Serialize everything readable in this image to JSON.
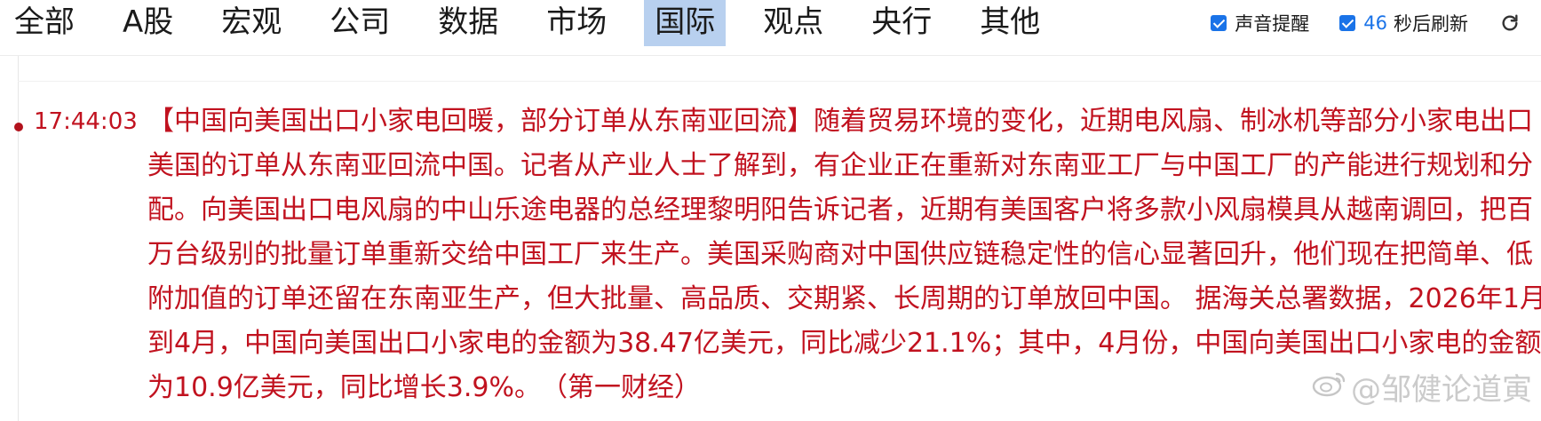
{
  "tabs": [
    {
      "label": "全部",
      "active": false
    },
    {
      "label": "A股",
      "active": false
    },
    {
      "label": "宏观",
      "active": false
    },
    {
      "label": "公司",
      "active": false
    },
    {
      "label": "数据",
      "active": false
    },
    {
      "label": "市场",
      "active": false
    },
    {
      "label": "国际",
      "active": true
    },
    {
      "label": "观点",
      "active": false
    },
    {
      "label": "央行",
      "active": false
    },
    {
      "label": "其他",
      "active": false
    }
  ],
  "controls": {
    "sound_label": "声音提醒",
    "sound_checked": true,
    "refresh_countdown": "46",
    "refresh_suffix": "秒后刷新",
    "refresh_checked": true,
    "refresh_icon": "refresh-icon"
  },
  "news": {
    "time": "17:44:03",
    "content": "【中国向美国出口小家电回暖，部分订单从东南亚回流】随着贸易环境的变化，近期电风扇、制冰机等部分小家电出口美国的订单从东南亚回流中国。记者从产业人士了解到，有企业正在重新对东南亚工厂与中国工厂的产能进行规划和分配。向美国出口电风扇的中山乐途电器的总经理黎明阳告诉记者，近期有美国客户将多款小风扇模具从越南调回，把百万台级别的批量订单重新交给中国工厂来生产。美国采购商对中国供应链稳定性的信心显著回升，他们现在把简单、低附加值的订单还留在东南亚生产，但大批量、高品质、交期紧、长周期的订单放回中国。 据海关总署数据，2026年1月到4月，中国向美国出口小家电的金额为38.47亿美元，同比减少21.1%；其中，4月份，中国向美国出口小家电的金额为10.9亿美元，同比增长3.9%。　（第一财经）"
  },
  "watermark": "@邹健论道寅",
  "colors": {
    "accent": "#1a73e8",
    "active_tab_bg": "#b8d0ef",
    "news_red": "#c1121f"
  }
}
